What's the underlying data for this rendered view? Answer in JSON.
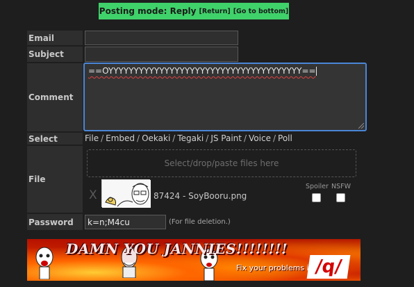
{
  "posting_mode": {
    "label": "Posting mode: Reply",
    "return_link": "[Return]",
    "bottom_link": "[Go to bottom]"
  },
  "form": {
    "email_label": "Email",
    "email_value": "",
    "subject_label": "Subject",
    "subject_value": "",
    "comment_label": "Comment",
    "comment_value": "==OYYYYYYYYYYYYYYYYYYYYYYYYYYYYYYYYYYYYYY==",
    "select_label": "Select",
    "select_options": [
      "File",
      "Embed",
      "Oekaki",
      "Tegaki",
      "JS Paint",
      "Voice",
      "Poll"
    ],
    "file_label": "File",
    "dropzone_text": "Select/drop/paste files here",
    "remove_symbol": "X",
    "filename": "87424 - SoyBooru.png",
    "spoiler_label": "Spoiler",
    "nsfw_label": "NSFW",
    "password_label": "Password",
    "password_value": "k=n;M4cu",
    "password_hint": "(For file deletion.)"
  },
  "banner": {
    "title": "DAMN YOU JANNIES!!!!!!!!",
    "subtitle": "Fix your problems in",
    "board": "/q/"
  },
  "colors": {
    "background": "#1e1e1e",
    "posting_mode_bg": "#3fd26a",
    "focus_border": "#4a86d8",
    "label_bg": "#2e2e2e"
  },
  "icons": {
    "remove": "close-icon",
    "resize": "resize-grip-icon"
  }
}
